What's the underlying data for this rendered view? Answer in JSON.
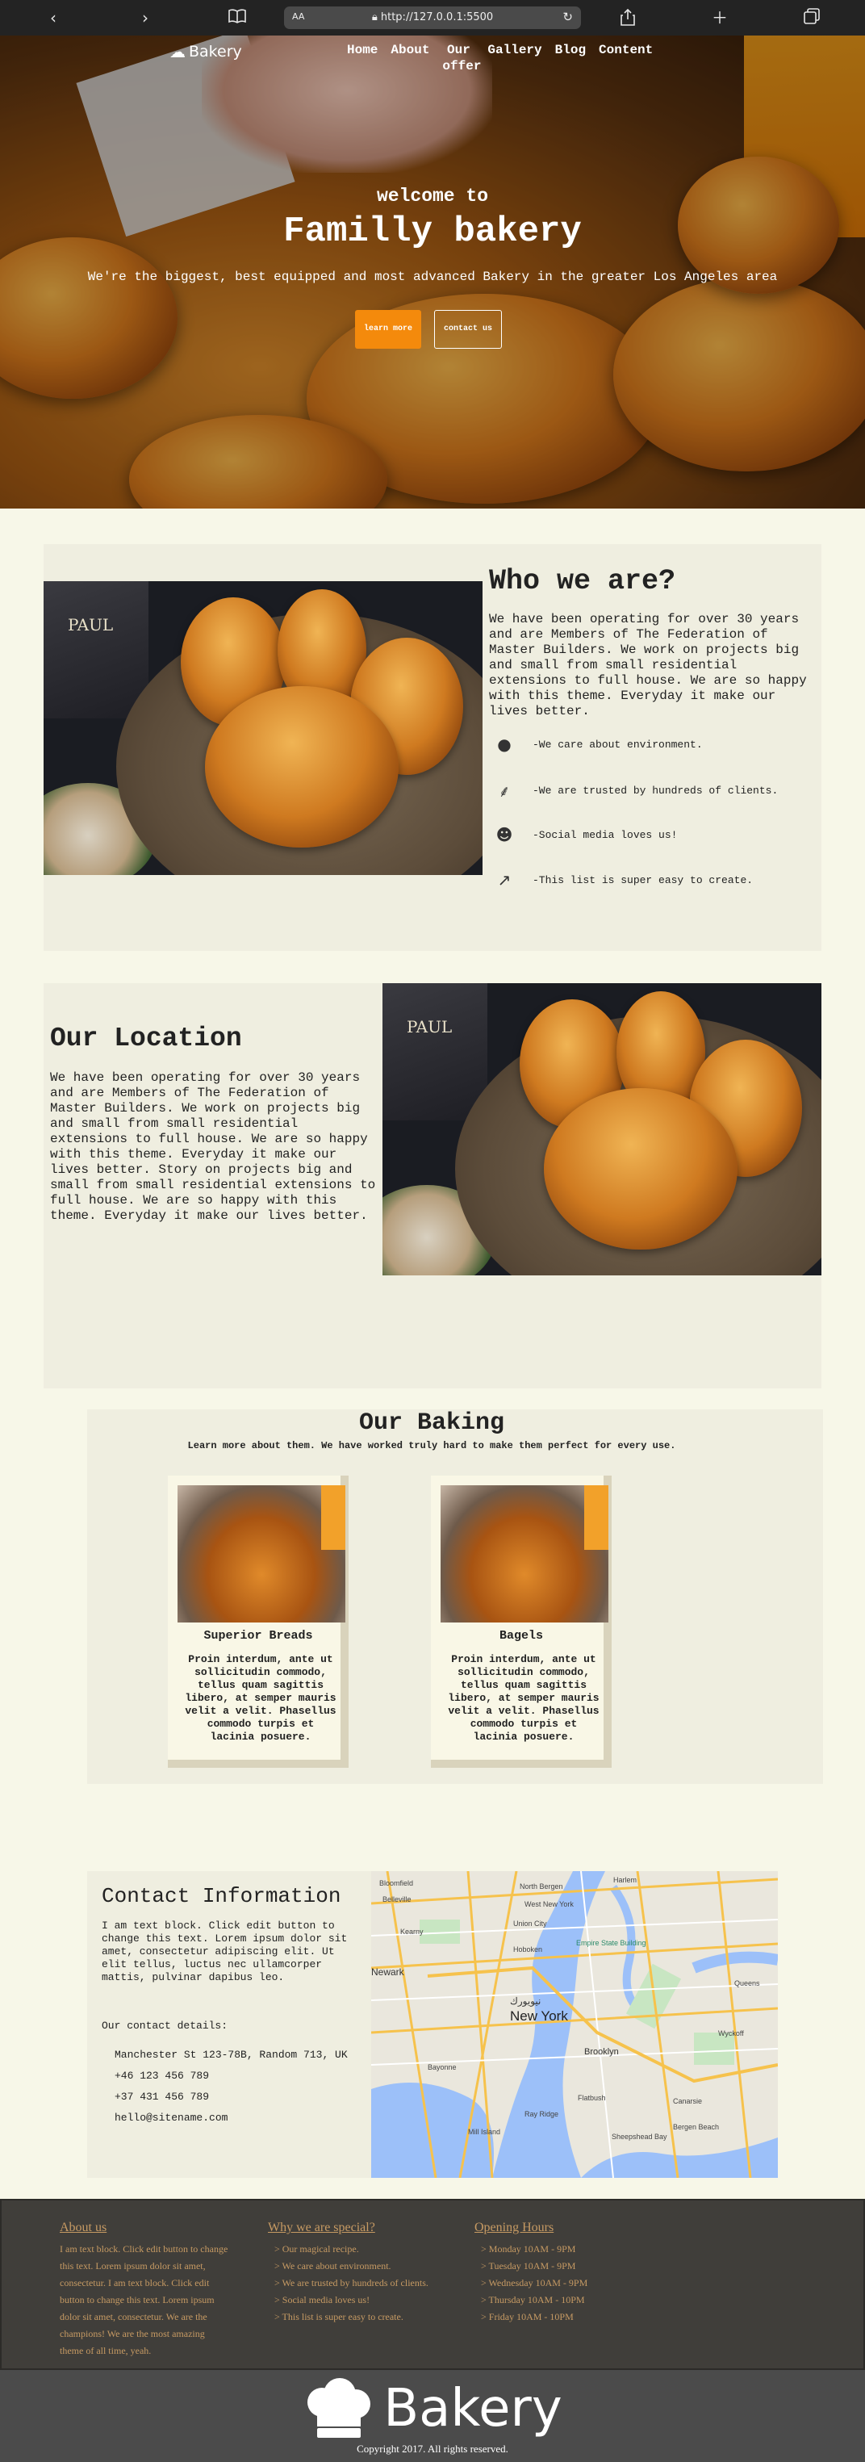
{
  "browser": {
    "text_size_label": "AA",
    "url": "http://127.0.0.1:5500",
    "back_icon": "‹",
    "forward_icon": "›",
    "reload_icon": "↻"
  },
  "nav": {
    "logo_text": "Bakery",
    "items": [
      "Home",
      "About",
      "Our offer",
      "Gallery",
      "Blog",
      "Content"
    ]
  },
  "hero": {
    "welcome": "welcome to",
    "title": "Familly bakery",
    "subtitle": "We're the biggest, best equipped and most advanced Bakery in the greater Los Angeles area",
    "learn_button": "learn more",
    "contact_button": "contact us"
  },
  "who": {
    "title": "Who we are?",
    "text": "We have been operating for over 30 years and are Members of The Federation of Master Builders. We work on projects big and small from small residential extensions to full house. We are so happy with this theme. Everyday it make our lives better.",
    "items": [
      {
        "icon": "apple-icon",
        "text": "-We care about environment."
      },
      {
        "icon": "wheat-icon",
        "text": "-We are trusted by hundreds of clients."
      },
      {
        "icon": "users-icon",
        "text": "-Social media loves us!"
      },
      {
        "icon": "trend-icon",
        "text": "-This list is super easy to create."
      }
    ],
    "photo_sign": "PAUL"
  },
  "location": {
    "title": "Our Location",
    "text": "We have been operating for over 30 years and are Members of The Federation of Master Builders. We work on projects big and small from small residential extensions to full house. We are so happy with this theme. Everyday it make our lives better. Story on projects big and small from small residential extensions to full house. We are so happy with this theme. Everyday it make our lives better."
  },
  "baking": {
    "title": "Our Baking",
    "subtitle": "Learn more about them. We have worked truly hard to make them perfect for every use.",
    "cards": [
      {
        "title": "Superior Breads",
        "text": "Proin interdum, ante ut sollicitudin commodo, tellus quam sagittis libero, at semper mauris velit a velit. Phasellus commodo turpis et lacinia posuere."
      },
      {
        "title": "Bagels",
        "text": "Proin interdum, ante ut sollicitudin commodo, tellus quam sagittis libero, at semper mauris velit a velit. Phasellus commodo turpis et lacinia posuere."
      }
    ]
  },
  "contact": {
    "title": "Contact Information",
    "text": "I am text block. Click edit button to change this text. Lorem ipsum dolor sit amet, consectetur adipiscing elit. Ut elit tellus, luctus nec ullamcorper mattis, pulvinar dapibus leo.",
    "details_label": "Our contact details:",
    "address": "Manchester St 123-78B, Random 713, UK",
    "phone1": "+46 123 456 789",
    "phone2": "+37 431 456 789",
    "email": "hello@sitename.com"
  },
  "map": {
    "city_label": "New York",
    "city_label_alt": "نيويورك",
    "labels": [
      "Belleville",
      "Bloomfield",
      "North Bergen",
      "Harlem",
      "West New York",
      "Union City",
      "Kearny",
      "Newark",
      "Hoboken",
      "Empire State Building",
      "Bayonne",
      "Brooklyn",
      "Flatbush",
      "Canarsie",
      "Queens",
      "Wyckoff",
      "Bergen Beach",
      "Sheepshead Bay",
      "Mill Island",
      "Ray Ridge"
    ]
  },
  "footer": {
    "about_title": "About us",
    "about_text": "I am text block. Click edit button to change this text. Lorem ipsum dolor sit amet, consectetur. I am text block. Click edit button to change this text. Lorem ipsum dolor sit amet, consectetur. We are the champions! We are the most amazing theme of all time, yeah.",
    "special_title": "Why we are special?",
    "special_items": [
      "> Our magical recipe.",
      "> We care about environment.",
      "> We are trusted by hundreds of clients.",
      "> Social media loves us!",
      "> This list is super easy to create."
    ],
    "hours_title": "Opening Hours",
    "hours_items": [
      "> Monday 10AM - 9PM",
      "> Tuesday 10AM - 9PM",
      "> Wednesday 10AM - 9PM",
      "> Thursday 10AM - 10PM",
      "> Friday 10AM - 10PM"
    ],
    "logo_text": "Bakery",
    "copyright": "Copyright 2017. All rights reserved."
  }
}
